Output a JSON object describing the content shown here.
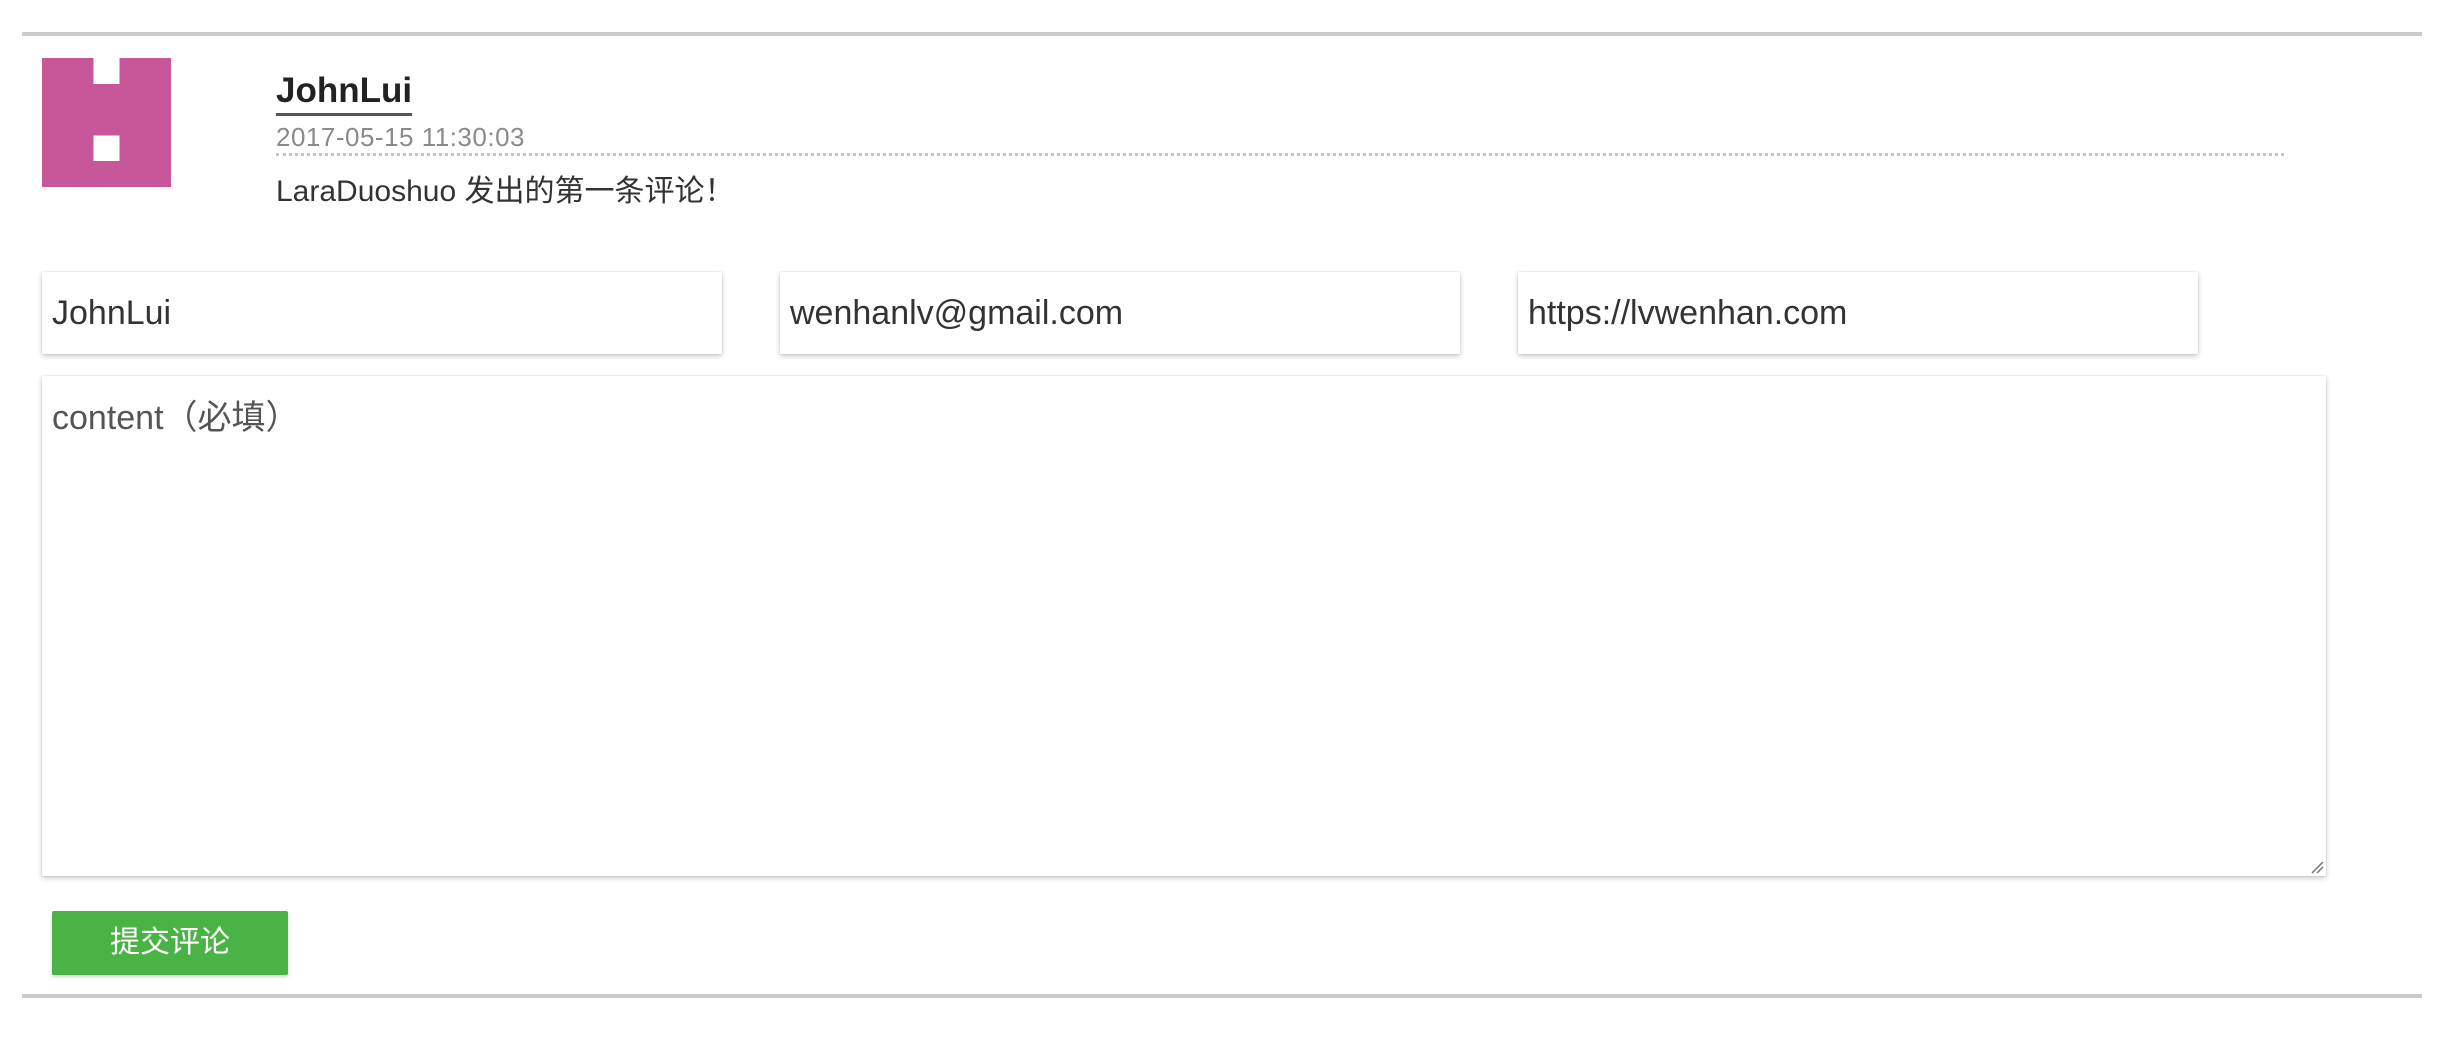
{
  "comment": {
    "author": "JohnLui",
    "timestamp": "2017-05-15 11:30:03",
    "text": "LaraDuoshuo 发出的第一条评论！",
    "avatar": {
      "icon": "identicon-avatar",
      "color": "#c8579a"
    }
  },
  "form": {
    "name_value": "JohnLui",
    "email_value": "wenhanlv@gmail.com",
    "url_value": "https://lvwenhan.com",
    "content_placeholder": "content（必填）",
    "submit_label": "提交评论",
    "submit_color": "#4ab346"
  }
}
